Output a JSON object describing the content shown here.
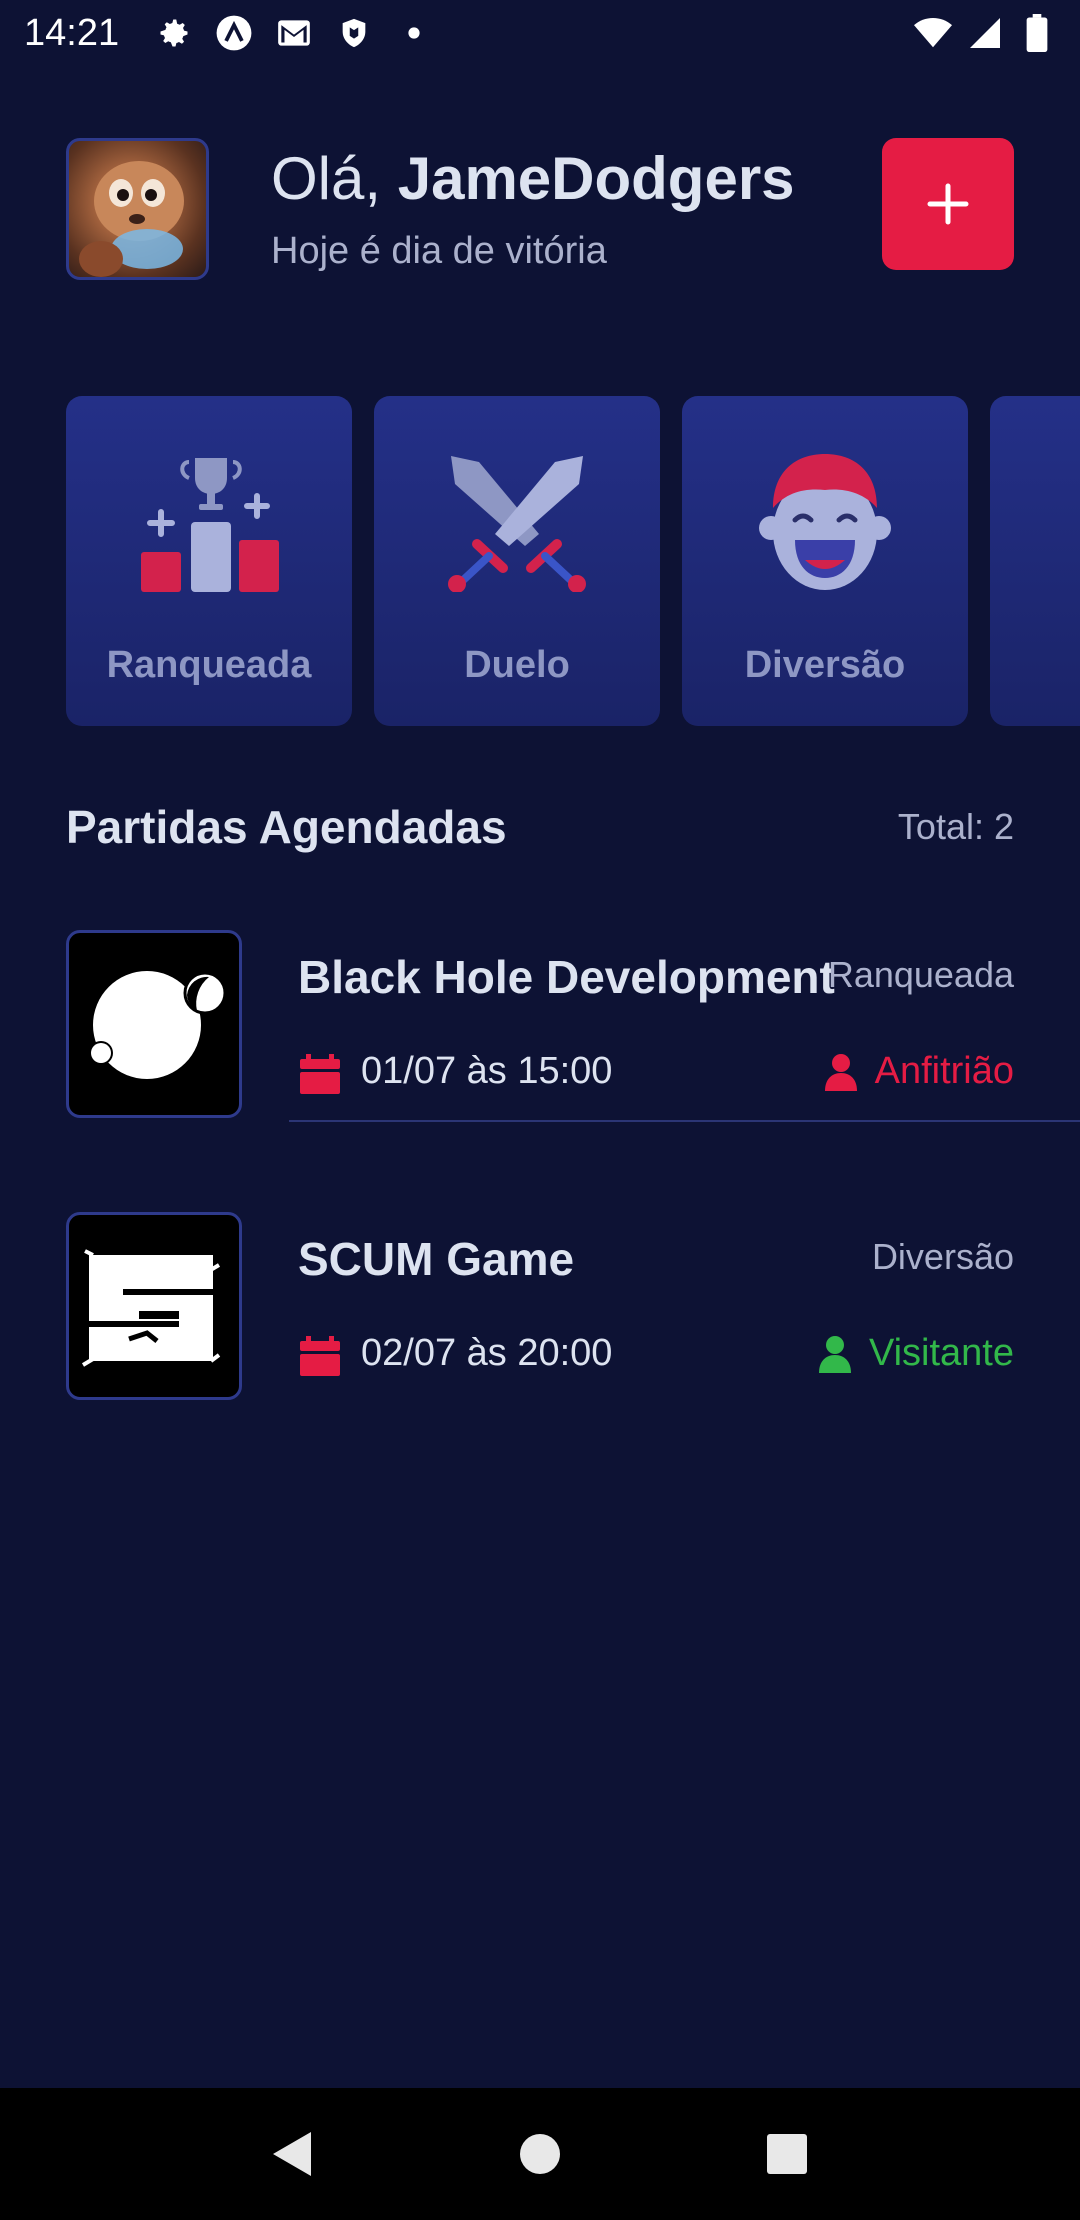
{
  "status_bar": {
    "time": "14:21"
  },
  "header": {
    "greeting_prefix": "Olá,",
    "username": "JameDodgers",
    "subtitle": "Hoje é dia de vitória",
    "add_button_label": "+"
  },
  "categories": [
    {
      "label": "Ranqueada",
      "icon": "ranked-icon"
    },
    {
      "label": "Duelo",
      "icon": "duel-icon"
    },
    {
      "label": "Diversão",
      "icon": "fun-icon"
    },
    {
      "label": "",
      "icon": "partial-icon"
    }
  ],
  "section": {
    "title": "Partidas Agendadas",
    "total": "Total: 2"
  },
  "matches": [
    {
      "title": "Black Hole Development",
      "category": "Ranqueada",
      "date": "01/07 às 15:00",
      "role": "Anfitrião",
      "role_color": "#e51c44"
    },
    {
      "title": "SCUM Game",
      "category": "Diversão",
      "date": "02/07 às 20:00",
      "role": "Visitante",
      "role_color": "#32b84a"
    }
  ],
  "colors": {
    "background": "#0d1234",
    "accent": "#e51c44",
    "success": "#32b84a",
    "card": "#1f2a78"
  }
}
